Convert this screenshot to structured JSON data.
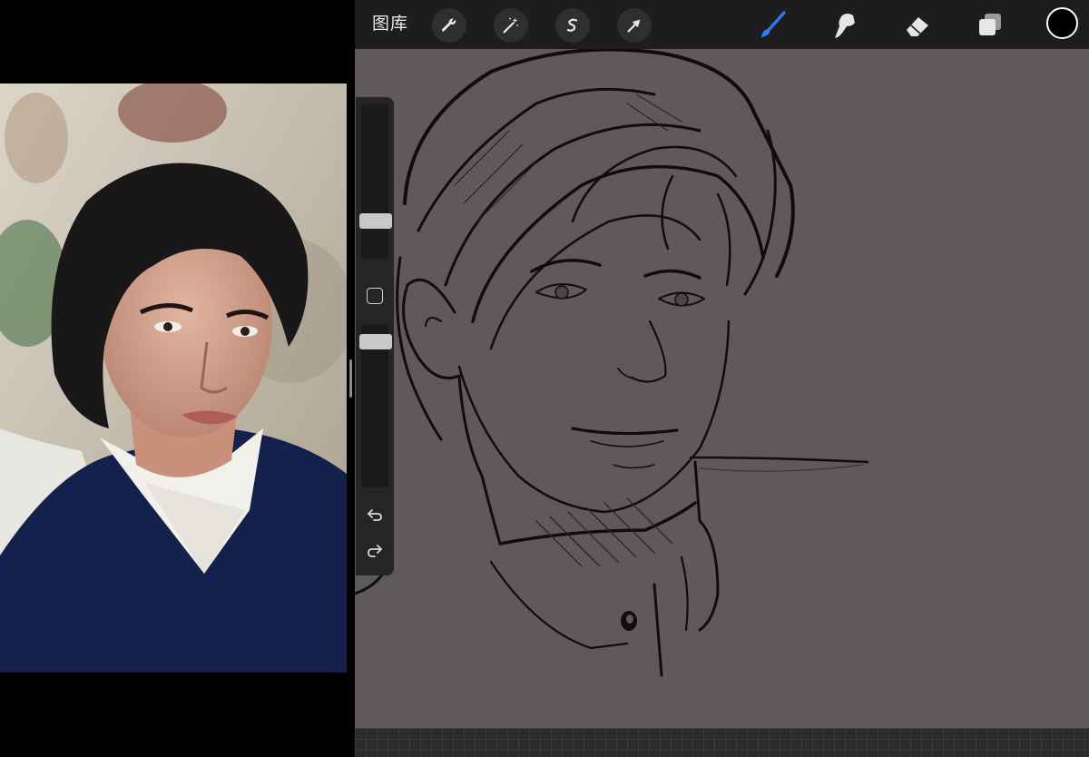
{
  "toolbar": {
    "gallery_label": "图库",
    "actions_icon": "wrench-icon",
    "adjustments_icon": "magic-wand-icon",
    "selection_icon": "selection-s-icon",
    "transform_icon": "arrow-cursor-icon",
    "brush_icon": "brush-icon",
    "smudge_icon": "smudge-icon",
    "eraser_icon": "eraser-icon",
    "layers_icon": "layers-icon",
    "active_tool": "brush",
    "current_color": "#000000"
  },
  "sidebar": {
    "brush_size_icon": "slider",
    "opacity_icon": "slider",
    "modify_icon": "square-icon",
    "undo_icon": "undo-icon",
    "redo_icon": "redo-icon"
  },
  "colors": {
    "canvas_bg": "#5f595a",
    "toolbar_bg": "#1d1d1f",
    "brush_active": "#1e6ee6"
  }
}
